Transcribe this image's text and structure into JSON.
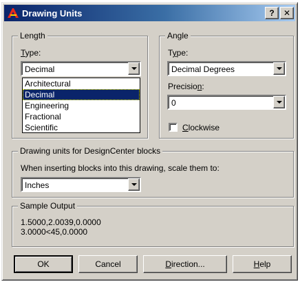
{
  "window": {
    "title": "Drawing Units",
    "help_button": "?",
    "close_button": "✕"
  },
  "length": {
    "legend": "Length",
    "type_label": "Type:",
    "type_value": "Decimal",
    "options": [
      "Architectural",
      "Decimal",
      "Engineering",
      "Fractional",
      "Scientific"
    ],
    "selected_index": 1
  },
  "angle": {
    "legend": "Angle",
    "type_label": "Type:",
    "type_value": "Decimal Degrees",
    "precision_label": "Precision:",
    "precision_value": "0",
    "clockwise_label": "Clockwise",
    "clockwise_checked": false
  },
  "designcenter": {
    "legend": "Drawing units for DesignCenter blocks",
    "prompt": "When inserting blocks into this drawing, scale them to:",
    "value": "Inches"
  },
  "sample": {
    "legend": "Sample Output",
    "line1": "1.5000,2.0039,0.0000",
    "line2": "3.0000<45,0.0000"
  },
  "buttons": {
    "ok": "OK",
    "cancel": "Cancel",
    "direction": "Direction...",
    "help": "Help"
  }
}
